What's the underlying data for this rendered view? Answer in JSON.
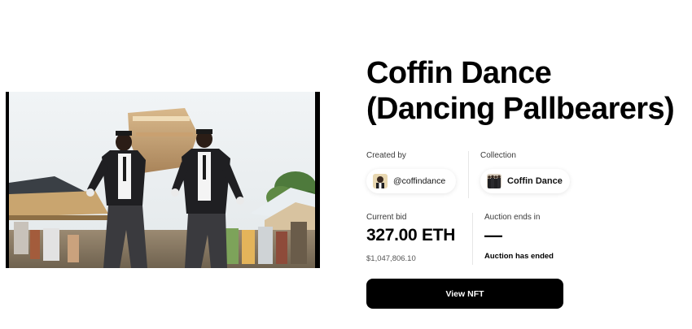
{
  "nft": {
    "title_line1": "Coffin Dance",
    "title_line2": "(Dancing Pallbearers)"
  },
  "creator": {
    "label": "Created by",
    "handle": "@coffindance",
    "avatar_icon": "creator-avatar"
  },
  "collection": {
    "label": "Collection",
    "name": "Coffin Dance",
    "avatar_icon": "collection-avatar"
  },
  "bid": {
    "label": "Current bid",
    "amount": "327.00 ETH",
    "usd": "$1,047,806.10"
  },
  "auction": {
    "label": "Auction ends in",
    "countdown": "—",
    "status": "Auction has ended"
  },
  "actions": {
    "view_label": "View NFT"
  },
  "media": {
    "description_icon": "nft-video-preview"
  },
  "colors": {
    "button_bg": "#000000",
    "button_text": "#ffffff",
    "text_primary": "#000000",
    "text_secondary": "#3a3a3a"
  }
}
